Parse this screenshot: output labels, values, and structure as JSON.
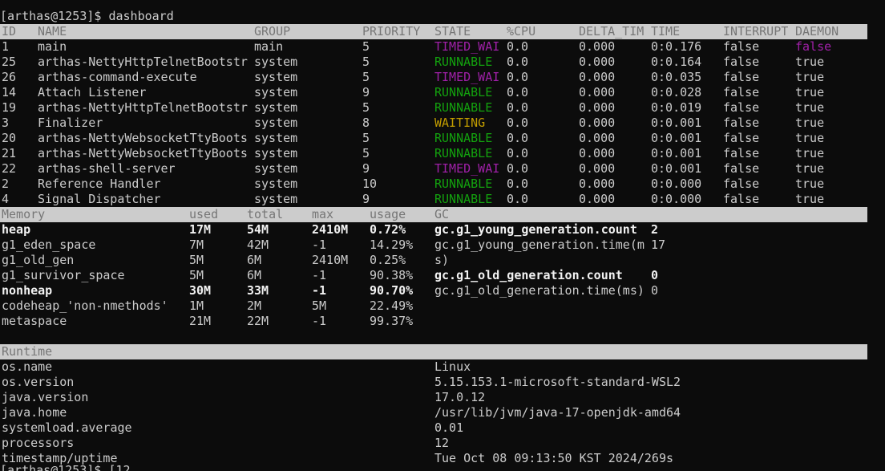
{
  "prompt": {
    "text": "[arthas@1253]$ dashboard",
    "next_partial": "[arthas@1253]$ [12"
  },
  "colors": {
    "runnable": "#13a10e",
    "timed_waiting": "#a020a8",
    "waiting": "#c19c00",
    "header_bg": "#cccccc",
    "header_fg": "#767676",
    "bg": "#0c0c0c",
    "fg": "#cccccc"
  },
  "threads": {
    "headers": [
      "ID",
      "NAME",
      "GROUP",
      "PRIORITY",
      "STATE",
      "%CPU",
      "DELTA_TIM",
      "TIME",
      "INTERRUPT",
      "DAEMON"
    ],
    "rows": [
      {
        "id": "1",
        "name": "main",
        "group": "main",
        "priority": "5",
        "state": "TIMED_WAI",
        "state_color": "#a020a8",
        "cpu": "0.0",
        "delta": "0.000",
        "time": "0:0.176",
        "interrupt": "false",
        "daemon": "false",
        "daemon_color": "#a020a8"
      },
      {
        "id": "25",
        "name": "arthas-NettyHttpTelnetBootstr",
        "group": "system",
        "priority": "5",
        "state": "RUNNABLE",
        "state_color": "#13a10e",
        "cpu": "0.0",
        "delta": "0.000",
        "time": "0:0.164",
        "interrupt": "false",
        "daemon": "true",
        "daemon_color": "#cccccc"
      },
      {
        "id": "26",
        "name": "arthas-command-execute",
        "group": "system",
        "priority": "5",
        "state": "TIMED_WAI",
        "state_color": "#a020a8",
        "cpu": "0.0",
        "delta": "0.000",
        "time": "0:0.035",
        "interrupt": "false",
        "daemon": "true",
        "daemon_color": "#cccccc"
      },
      {
        "id": "14",
        "name": "Attach Listener",
        "group": "system",
        "priority": "9",
        "state": "RUNNABLE",
        "state_color": "#13a10e",
        "cpu": "0.0",
        "delta": "0.000",
        "time": "0:0.028",
        "interrupt": "false",
        "daemon": "true",
        "daemon_color": "#cccccc"
      },
      {
        "id": "19",
        "name": "arthas-NettyHttpTelnetBootstr",
        "group": "system",
        "priority": "5",
        "state": "RUNNABLE",
        "state_color": "#13a10e",
        "cpu": "0.0",
        "delta": "0.000",
        "time": "0:0.019",
        "interrupt": "false",
        "daemon": "true",
        "daemon_color": "#cccccc"
      },
      {
        "id": "3",
        "name": "Finalizer",
        "group": "system",
        "priority": "8",
        "state": "WAITING",
        "state_color": "#c19c00",
        "cpu": "0.0",
        "delta": "0.000",
        "time": "0:0.001",
        "interrupt": "false",
        "daemon": "true",
        "daemon_color": "#cccccc"
      },
      {
        "id": "20",
        "name": "arthas-NettyWebsocketTtyBoots",
        "group": "system",
        "priority": "5",
        "state": "RUNNABLE",
        "state_color": "#13a10e",
        "cpu": "0.0",
        "delta": "0.000",
        "time": "0:0.001",
        "interrupt": "false",
        "daemon": "true",
        "daemon_color": "#cccccc"
      },
      {
        "id": "21",
        "name": "arthas-NettyWebsocketTtyBoots",
        "group": "system",
        "priority": "5",
        "state": "RUNNABLE",
        "state_color": "#13a10e",
        "cpu": "0.0",
        "delta": "0.000",
        "time": "0:0.001",
        "interrupt": "false",
        "daemon": "true",
        "daemon_color": "#cccccc"
      },
      {
        "id": "22",
        "name": "arthas-shell-server",
        "group": "system",
        "priority": "9",
        "state": "TIMED_WAI",
        "state_color": "#a020a8",
        "cpu": "0.0",
        "delta": "0.000",
        "time": "0:0.001",
        "interrupt": "false",
        "daemon": "true",
        "daemon_color": "#cccccc"
      },
      {
        "id": "2",
        "name": "Reference Handler",
        "group": "system",
        "priority": "10",
        "state": "RUNNABLE",
        "state_color": "#13a10e",
        "cpu": "0.0",
        "delta": "0.000",
        "time": "0:0.000",
        "interrupt": "false",
        "daemon": "true",
        "daemon_color": "#cccccc"
      },
      {
        "id": "4",
        "name": "Signal Dispatcher",
        "group": "system",
        "priority": "9",
        "state": "RUNNABLE",
        "state_color": "#13a10e",
        "cpu": "0.0",
        "delta": "0.000",
        "time": "0:0.000",
        "interrupt": "false",
        "daemon": "true",
        "daemon_color": "#cccccc"
      }
    ]
  },
  "memory": {
    "headers": [
      "Memory",
      "used",
      "total",
      "max",
      "usage",
      "GC"
    ],
    "rows": [
      {
        "name": "heap",
        "used": "17M",
        "total": "54M",
        "max": "2410M",
        "usage": "0.72%",
        "gc_key": "gc.g1_young_generation.count",
        "gc_val": "2",
        "bold": true,
        "gc_bold": true
      },
      {
        "name": "g1_eden_space",
        "used": "7M",
        "total": "42M",
        "max": "-1",
        "usage": "14.29%",
        "gc_key": "gc.g1_young_generation.time(m",
        "gc_val": "17",
        "bold": false,
        "gc_bold": false
      },
      {
        "name": "g1_old_gen",
        "used": "5M",
        "total": "6M",
        "max": "2410M",
        "usage": "0.25%",
        "gc_key": "s)",
        "gc_val": "",
        "bold": false,
        "gc_bold": false
      },
      {
        "name": "g1_survivor_space",
        "used": "5M",
        "total": "6M",
        "max": "-1",
        "usage": "90.38%",
        "gc_key": "gc.g1_old_generation.count",
        "gc_val": "0",
        "bold": false,
        "gc_bold": true
      },
      {
        "name": "nonheap",
        "used": "30M",
        "total": "33M",
        "max": "-1",
        "usage": "90.70%",
        "gc_key": "gc.g1_old_generation.time(ms)",
        "gc_val": "0",
        "bold": true,
        "gc_bold": false
      },
      {
        "name": "codeheap_'non-nmethods'",
        "used": "1M",
        "total": "2M",
        "max": "5M",
        "usage": "22.49%",
        "gc_key": "",
        "gc_val": "",
        "bold": false,
        "gc_bold": false
      },
      {
        "name": "metaspace",
        "used": "21M",
        "total": "22M",
        "max": "-1",
        "usage": "99.37%",
        "gc_key": "",
        "gc_val": "",
        "bold": false,
        "gc_bold": false
      }
    ]
  },
  "runtime": {
    "header": "Runtime",
    "rows": [
      {
        "key": "os.name",
        "value": "Linux"
      },
      {
        "key": "os.version",
        "value": "5.15.153.1-microsoft-standard-WSL2"
      },
      {
        "key": "java.version",
        "value": "17.0.12"
      },
      {
        "key": "java.home",
        "value": "/usr/lib/jvm/java-17-openjdk-amd64"
      },
      {
        "key": "systemload.average",
        "value": "0.01"
      },
      {
        "key": "processors",
        "value": "12"
      },
      {
        "key": "timestamp/uptime",
        "value": "Tue Oct 08 09:13:50 KST 2024/269s"
      }
    ]
  }
}
